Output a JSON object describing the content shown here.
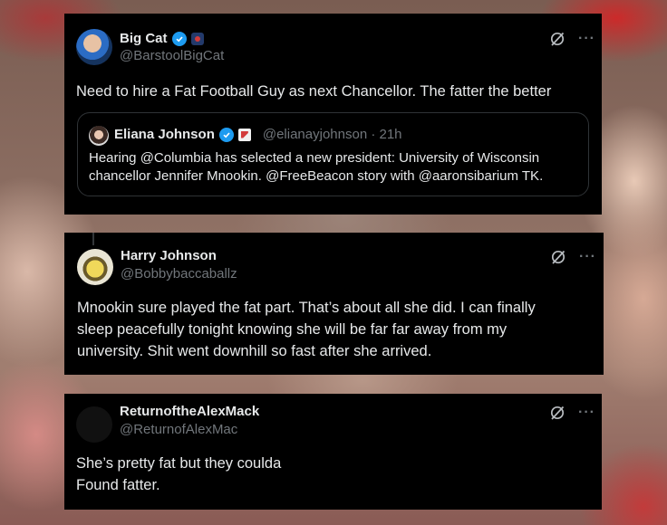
{
  "posts": [
    {
      "display_name": "Big Cat",
      "handle": "@BarstoolBigCat",
      "text": "Need to hire a Fat Football Guy as next Chancellor. The fatter the better",
      "quote": {
        "display_name": "Eliana Johnson",
        "handle_time": "@elianayjohnson · 21h",
        "text": "Hearing @Columbia has selected a new president: University of Wisconsin chancellor Jennifer Mnookin. @FreeBeacon story with @aaronsibarium TK."
      }
    },
    {
      "display_name": "Harry Johnson",
      "handle": "@Bobbybaccaballz",
      "text_lines": [
        "Mnookin sure played the fat part. That’s about all she did. I can finally",
        "sleep peacefully tonight knowing she will be far far away from my",
        "university. Shit went downhill so fast after she arrived."
      ]
    },
    {
      "display_name": "ReturnoftheAlexMack",
      "handle": "@ReturnofAlexMac",
      "text_lines": [
        "She’s pretty fat but they coulda",
        "Found fatter."
      ]
    }
  ],
  "icons": {
    "verified": "verified-badge-icon",
    "grok": "grok-icon",
    "more": "more-icon"
  },
  "colors": {
    "card_bg": "#000000",
    "text": "#e7e9ea",
    "muted": "#71767b",
    "verified": "#1d9bf0"
  }
}
